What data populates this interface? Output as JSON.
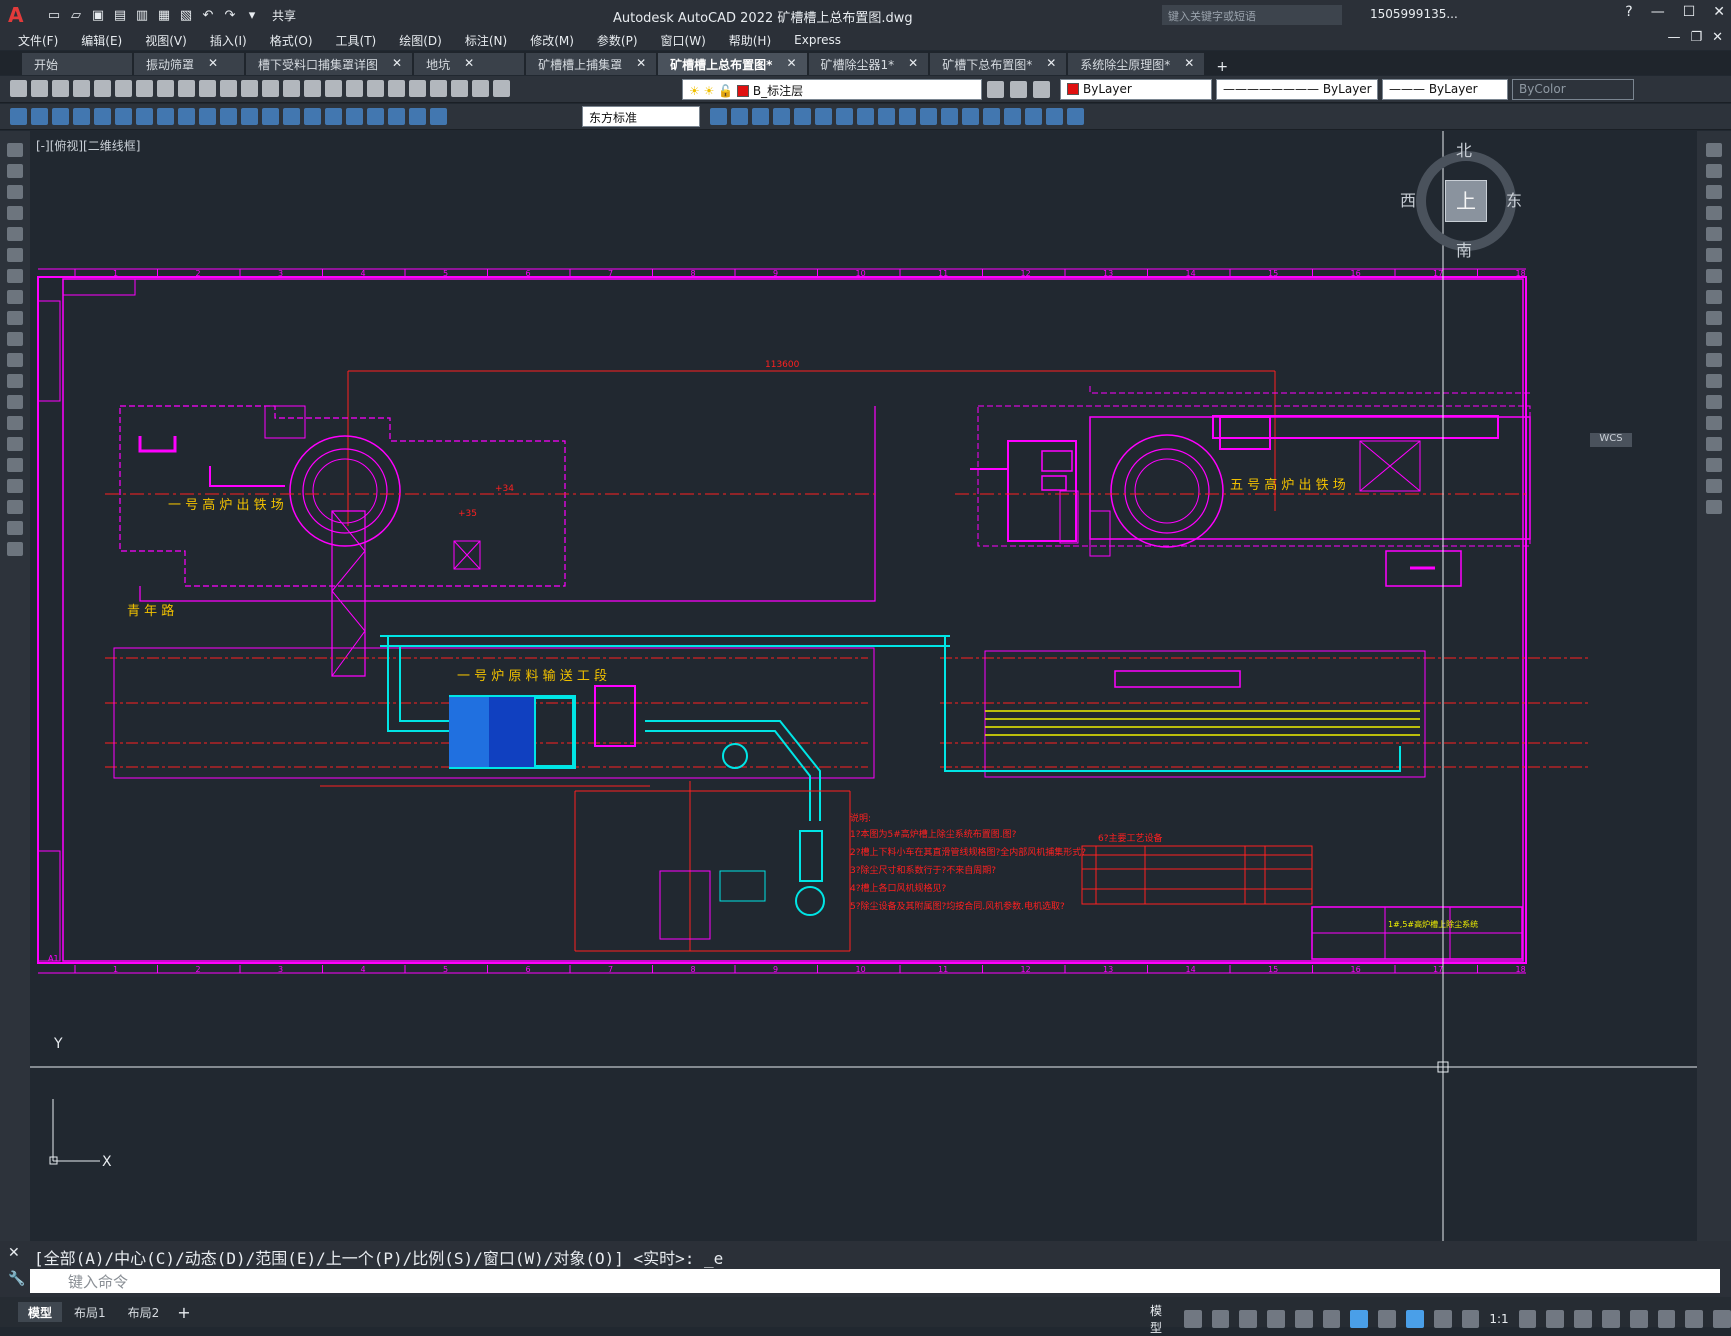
{
  "app": {
    "window_title": "Autodesk AutoCAD 2022    矿槽槽上总布置图.dwg",
    "share_label": "共享",
    "search_placeholder": "键入关键字或短语",
    "user_label": "1505999135..."
  },
  "menu": [
    "文件(F)",
    "编辑(E)",
    "视图(V)",
    "插入(I)",
    "格式(O)",
    "工具(T)",
    "绘图(D)",
    "标注(N)",
    "修改(M)",
    "参数(P)",
    "窗口(W)",
    "帮助(H)",
    "Express"
  ],
  "tabs": [
    {
      "label": "开始",
      "active": false,
      "closable": false
    },
    {
      "label": "振动筛罩",
      "active": false,
      "closable": true
    },
    {
      "label": "槽下受料口捕集罩详图",
      "active": false,
      "closable": true
    },
    {
      "label": "地坑",
      "active": false,
      "closable": true
    },
    {
      "label": "矿槽槽上捕集罩",
      "active": false,
      "closable": true
    },
    {
      "label": "矿槽槽上总布置图*",
      "active": true,
      "closable": true
    },
    {
      "label": "矿槽除尘器1*",
      "active": false,
      "closable": true
    },
    {
      "label": "矿槽下总布置图*",
      "active": false,
      "closable": true
    },
    {
      "label": "系统除尘原理图*",
      "active": false,
      "closable": true
    }
  ],
  "toolbar": {
    "layer_value": "B_标注层",
    "color_value": "ByLayer",
    "linetype_value": "ByLayer",
    "lineweight_value": "ByLayer",
    "plotstyle_value": "ByColor",
    "dimstyle_value": "东方标准",
    "color_swatch": "#e01010"
  },
  "viewport": {
    "view_label": "[-][俯视][二维线框]",
    "viewcube": {
      "north": "北",
      "south": "南",
      "east": "东",
      "west": "西",
      "face": "上",
      "wcs": "WCS"
    }
  },
  "drawing": {
    "label_left_site": "一  号  高  炉  出  铁  场",
    "label_right_site": "五  号  高  炉  出  铁  场",
    "label_transport": "一  号  炉  原  料  输  送  工  段",
    "label_road": "青     年     路",
    "dim_top": "113600",
    "notes_title": "说明:",
    "notes": [
      "1?本图为5#高炉槽上除尘系统布置图.图?",
      "2?槽上下料小车在其直滑管线规格图?全内部风机捕集形式?",
      "3?除尘尺寸和系数行于?不来自周期?",
      "4?槽上各口风机规格见?",
      "5?除尘设备及其附属图?均按合同.风机参数.电机选取?"
    ],
    "equip_title": "6?主要工艺设备",
    "column_grid_numbers": [
      "1",
      "2",
      "3",
      "4",
      "5",
      "6",
      "7",
      "8",
      "9",
      "10",
      "11",
      "12",
      "13",
      "14",
      "15",
      "16",
      "17",
      "18"
    ],
    "title_block_text": "1#,5#高炉槽上除尘系统",
    "sheet_label": "A1"
  },
  "command": {
    "history": "[全部(A)/中心(C)/动态(D)/范围(E)/上一个(P)/比例(S)/窗口(W)/对象(O)] <实时>: _e",
    "placeholder": "键入命令"
  },
  "status": {
    "tabs": [
      "模型",
      "布局1",
      "布局2"
    ],
    "model_label": "模型",
    "scale": "1:1"
  },
  "colors": {
    "magenta": "#ff00ff",
    "red": "#ff2020",
    "cyan": "#00e5e5",
    "yellow": "#f0f000",
    "white": "#f0f0f0"
  }
}
